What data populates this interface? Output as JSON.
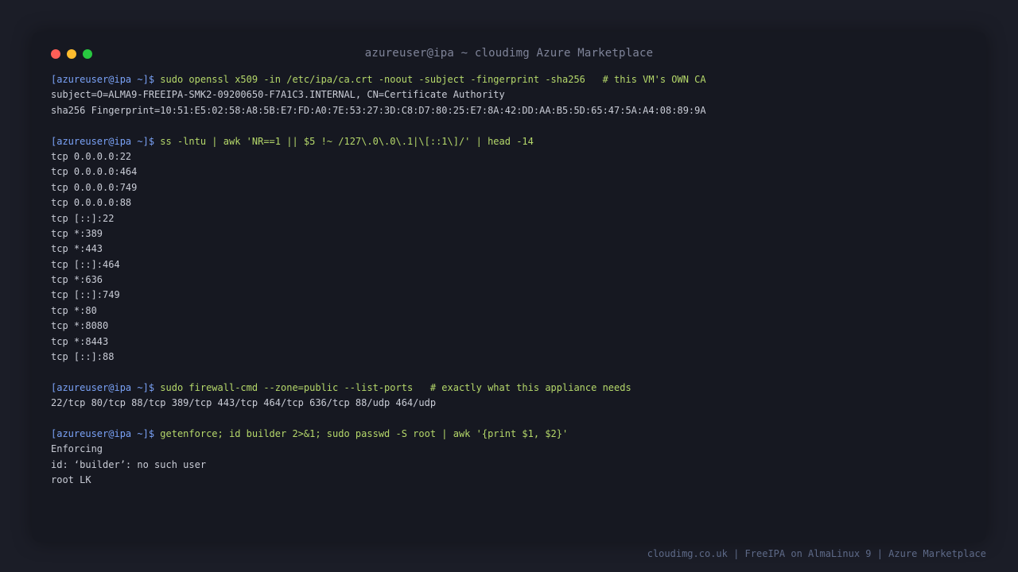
{
  "window": {
    "title": "azureuser@ipa ~ cloudimg Azure Marketplace"
  },
  "colors": {
    "background": "#1b1d27",
    "terminal": "#161821",
    "prompt": "#7aa2f7",
    "command": "#b5d86a",
    "output": "#c9ccd6",
    "close": "#fe5f57",
    "minimize": "#febc2e",
    "maximize": "#28c840"
  },
  "terminal": {
    "prompt": "[azureuser@ipa ~]$ ",
    "blocks": [
      {
        "command": "sudo openssl x509 -in /etc/ipa/ca.crt -noout -subject -fingerprint -sha256   # this VM's OWN CA",
        "output": [
          "subject=O=ALMA9-FREEIPA-SMK2-09200650-F7A1C3.INTERNAL, CN=Certificate Authority",
          "sha256 Fingerprint=10:51:E5:02:58:A8:5B:E7:FD:A0:7E:53:27:3D:C8:D7:80:25:E7:8A:42:DD:AA:B5:5D:65:47:5A:A4:08:89:9A"
        ]
      },
      {
        "command": "ss -lntu | awk 'NR==1 || $5 !~ /127\\.0\\.0\\.1|\\[::1\\]/' | head -14",
        "output": [
          "tcp 0.0.0.0:22",
          "tcp 0.0.0.0:464",
          "tcp 0.0.0.0:749",
          "tcp 0.0.0.0:88",
          "tcp [::]:22",
          "tcp *:389",
          "tcp *:443",
          "tcp [::]:464",
          "tcp *:636",
          "tcp [::]:749",
          "tcp *:80",
          "tcp *:8080",
          "tcp *:8443",
          "tcp [::]:88"
        ]
      },
      {
        "command": "sudo firewall-cmd --zone=public --list-ports   # exactly what this appliance needs",
        "output": [
          "22/tcp 80/tcp 88/tcp 389/tcp 443/tcp 464/tcp 636/tcp 88/udp 464/udp"
        ]
      },
      {
        "command": "getenforce; id builder 2>&1; sudo passwd -S root | awk '{print $1, $2}'",
        "output": [
          "Enforcing",
          "id: ‘builder’: no such user",
          "root LK"
        ]
      }
    ]
  },
  "footer": {
    "text": "cloudimg.co.uk | FreeIPA on AlmaLinux 9 | Azure Marketplace"
  }
}
